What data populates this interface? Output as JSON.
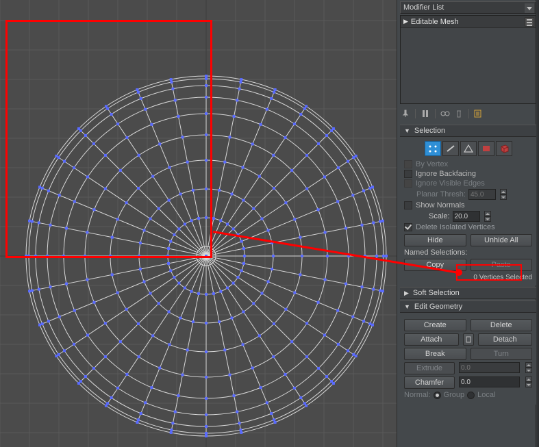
{
  "top_dropdown": "Modifier List",
  "stack": {
    "item": "Editable Mesh"
  },
  "pin_tooltip": "Pin Stack",
  "rollouts": {
    "selection": {
      "title": "Selection",
      "by_vertex": "By Vertex",
      "ignore_backfacing": "Ignore Backfacing",
      "ignore_visible_edges": "Ignore Visible Edges",
      "planar_thresh_label": "Planar Thresh:",
      "planar_thresh_value": "45.0",
      "show_normals": "Show Normals",
      "scale_label": "Scale:",
      "scale_value": "20.0",
      "delete_isolated": "Delete Isolated Vertices",
      "hide_btn": "Hide",
      "unhide_btn": "Unhide All",
      "named_sel_label": "Named Selections:",
      "copy_btn": "Copy",
      "paste_btn": "Paste",
      "status": "0 Vertices Selected"
    },
    "soft_selection": {
      "title": "Soft Selection"
    },
    "edit_geometry": {
      "title": "Edit Geometry",
      "create": "Create",
      "delete": "Delete",
      "attach": "Attach",
      "detach": "Detach",
      "break": "Break",
      "turn": "Turn",
      "extrude": "Extrude",
      "extrude_val": "0.0",
      "chamfer": "Chamfer",
      "chamfer_val": "0.0",
      "normal_label": "Normal:",
      "group_label": "Group",
      "local_label": "Local"
    }
  },
  "colors": {
    "accent": "#2f8fd6",
    "vertex": "#5a6bff",
    "mesh": "#d8d8d8",
    "grid_bg": "#4b4b4b",
    "highlight": "#ff0000"
  }
}
